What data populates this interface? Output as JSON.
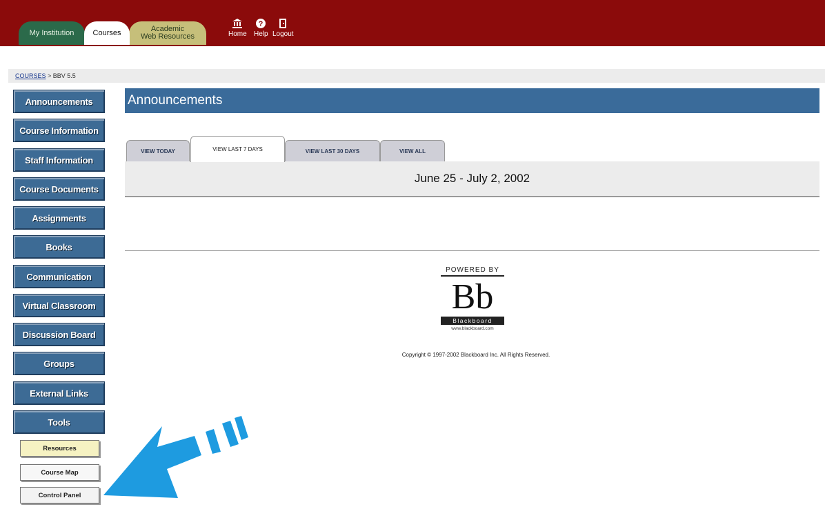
{
  "header": {
    "tabs": [
      {
        "label": "My Institution"
      },
      {
        "label": "Courses"
      },
      {
        "label": "Academic\nWeb Resources"
      }
    ],
    "nav": {
      "home": "Home",
      "help": "Help",
      "logout": "Logout"
    }
  },
  "breadcrumb": {
    "link": "COURSES",
    "separator": " > ",
    "current": "BBV 5.5"
  },
  "sidebar": {
    "items": [
      {
        "label": "Announcements"
      },
      {
        "label": "Course Information"
      },
      {
        "label": "Staff Information"
      },
      {
        "label": "Course Documents"
      },
      {
        "label": "Assignments"
      },
      {
        "label": "Books"
      },
      {
        "label": "Communication"
      },
      {
        "label": "Virtual Classroom"
      },
      {
        "label": "Discussion Board"
      },
      {
        "label": "Groups"
      },
      {
        "label": "External Links"
      },
      {
        "label": "Tools"
      }
    ],
    "sub_buttons": {
      "resources": "Resources",
      "course_map": "Course Map",
      "control_panel": "Control Panel"
    }
  },
  "main": {
    "title": "Announcements",
    "view_tabs": [
      {
        "label": "VIEW TODAY"
      },
      {
        "label": "VIEW LAST 7 DAYS"
      },
      {
        "label": "VIEW LAST 30 DAYS"
      },
      {
        "label": "VIEW ALL"
      }
    ],
    "date_range": "June 25 - July 2, 2002"
  },
  "footer": {
    "powered_by": "POWERED BY",
    "logo_text": "Bb",
    "brand": "Blackboard",
    "url": "www.blackboard.com",
    "copyright": "Copyright © 1997-2002 Blackboard Inc. All Rights Reserved."
  },
  "colors": {
    "header_bg": "#8b0b0b",
    "nav_button": "#3d6b95",
    "section_header": "#3a6b9a",
    "arrow": "#1e9be0"
  }
}
